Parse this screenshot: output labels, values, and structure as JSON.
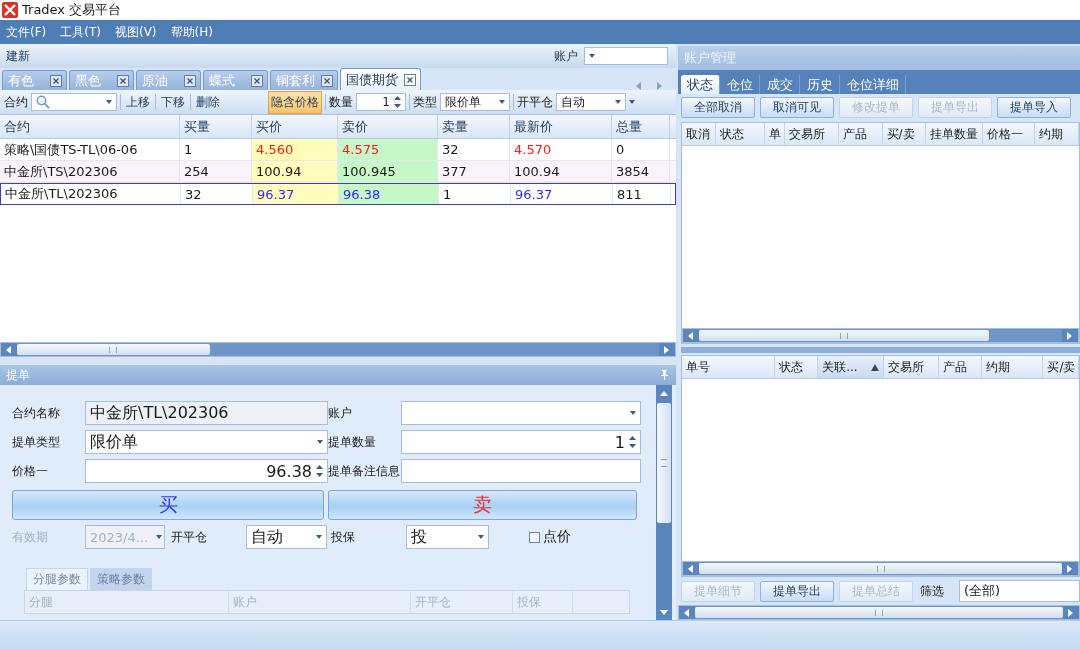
{
  "window": {
    "title": "Tradex 交易平台"
  },
  "menu": [
    "文件(F)",
    "工具(T)",
    "视图(V)",
    "帮助(H)"
  ],
  "quote_panel": {
    "title": "建新",
    "account_label": "账户",
    "tabs": [
      {
        "label": "有色",
        "selected": false
      },
      {
        "label": "黑色",
        "selected": false
      },
      {
        "label": "原油",
        "selected": false
      },
      {
        "label": "蝶式",
        "selected": false
      },
      {
        "label": "铜套利",
        "selected": false
      },
      {
        "label": "国债期货",
        "selected": true
      }
    ],
    "toolbar": {
      "contract_label": "合约",
      "up": "上移",
      "down": "下移",
      "delete": "删除",
      "implied": {
        "label": "隐含价格",
        "on": true
      },
      "qty_label": "数量",
      "qty_value": "1",
      "type_label": "类型",
      "type_value": "限价单",
      "openclose_label": "开平仓",
      "openclose_value": "自动"
    },
    "table": {
      "columns": [
        {
          "label": "合约",
          "kind": "text"
        },
        {
          "label": "买量",
          "kind": "text"
        },
        {
          "label": "买价",
          "kind": "bid"
        },
        {
          "label": "卖价",
          "kind": "ask"
        },
        {
          "label": "卖量",
          "kind": "text"
        },
        {
          "label": "最新价",
          "kind": "last"
        },
        {
          "label": "总量",
          "kind": "text"
        }
      ],
      "rows": [
        {
          "cells": [
            "策略\\国债TS-TL\\06-06",
            "1",
            "4.560",
            "4.575",
            "32",
            "4.570",
            "0"
          ],
          "color": "#ff1a1a",
          "selected": false
        },
        {
          "cells": [
            "中金所\\TS\\202306",
            "254",
            "100.94",
            "100.945",
            "377",
            "100.94",
            "3854"
          ],
          "color": "#1a1a1a",
          "selected": false
        },
        {
          "cells": [
            "中金所\\TL\\202306",
            "32",
            "96.37",
            "96.38",
            "1",
            "96.37",
            "811"
          ],
          "color": "#2b2bff",
          "selected": true
        }
      ]
    }
  },
  "order": {
    "title": "提单",
    "contract_label": "合约名称",
    "contract_value": "中金所\\TL\\202306",
    "account_label": "账户",
    "type_label": "提单类型",
    "type_value": "限价单",
    "qty_label": "提单数量",
    "qty_value": "1",
    "price_label": "价格一",
    "price_value": "96.38",
    "note_label": "提单备注信息",
    "buy": "买",
    "sell": "卖",
    "expiry": {
      "label": "有效期",
      "value": "2023/4...",
      "disabled": true
    },
    "openclose_label": "开平仓",
    "openclose_value": "自动",
    "hedge_label": "投保",
    "hedge_value": "投",
    "point_price": {
      "label": "点价",
      "checked": false
    },
    "subtabs": [
      {
        "label": "分腿参数",
        "selected": true
      },
      {
        "label": "策略参数",
        "selected": false
      }
    ],
    "leg_columns": [
      "分腿",
      "账户",
      "开平仓",
      "投保"
    ]
  },
  "account_panel": {
    "title": "账户管理",
    "tabs": [
      {
        "label": "状态",
        "selected": true
      },
      {
        "label": "仓位",
        "selected": false
      },
      {
        "label": "成交",
        "selected": false
      },
      {
        "label": "历史",
        "selected": false
      },
      {
        "label": "仓位详细",
        "selected": false
      }
    ],
    "buttons": [
      {
        "label": "全部取消",
        "disabled": false
      },
      {
        "label": "取消可见",
        "disabled": false
      },
      {
        "label": "修改提单",
        "disabled": true
      },
      {
        "label": "提单导出",
        "disabled": true
      },
      {
        "label": "提单导入",
        "disabled": false
      }
    ],
    "orders_columns": [
      "取消",
      "状态",
      "单",
      "交易所",
      "产品",
      "买/卖",
      "挂单数量",
      "价格一",
      "约期"
    ],
    "detail_columns": [
      {
        "label": "单号",
        "sorted": false
      },
      {
        "label": "状态",
        "sorted": false
      },
      {
        "label": "关联...",
        "sorted": true
      },
      {
        "label": "交易所",
        "sorted": false
      },
      {
        "label": "产品",
        "sorted": false
      },
      {
        "label": "约期",
        "sorted": false
      },
      {
        "label": "买/卖",
        "sorted": false
      }
    ],
    "bottom_buttons": [
      {
        "label": "提单细节",
        "disabled": true
      },
      {
        "label": "提单导出",
        "disabled": false
      },
      {
        "label": "提单总结",
        "disabled": true
      }
    ],
    "filter_label": "筛选",
    "filter_value": "(全部)"
  }
}
